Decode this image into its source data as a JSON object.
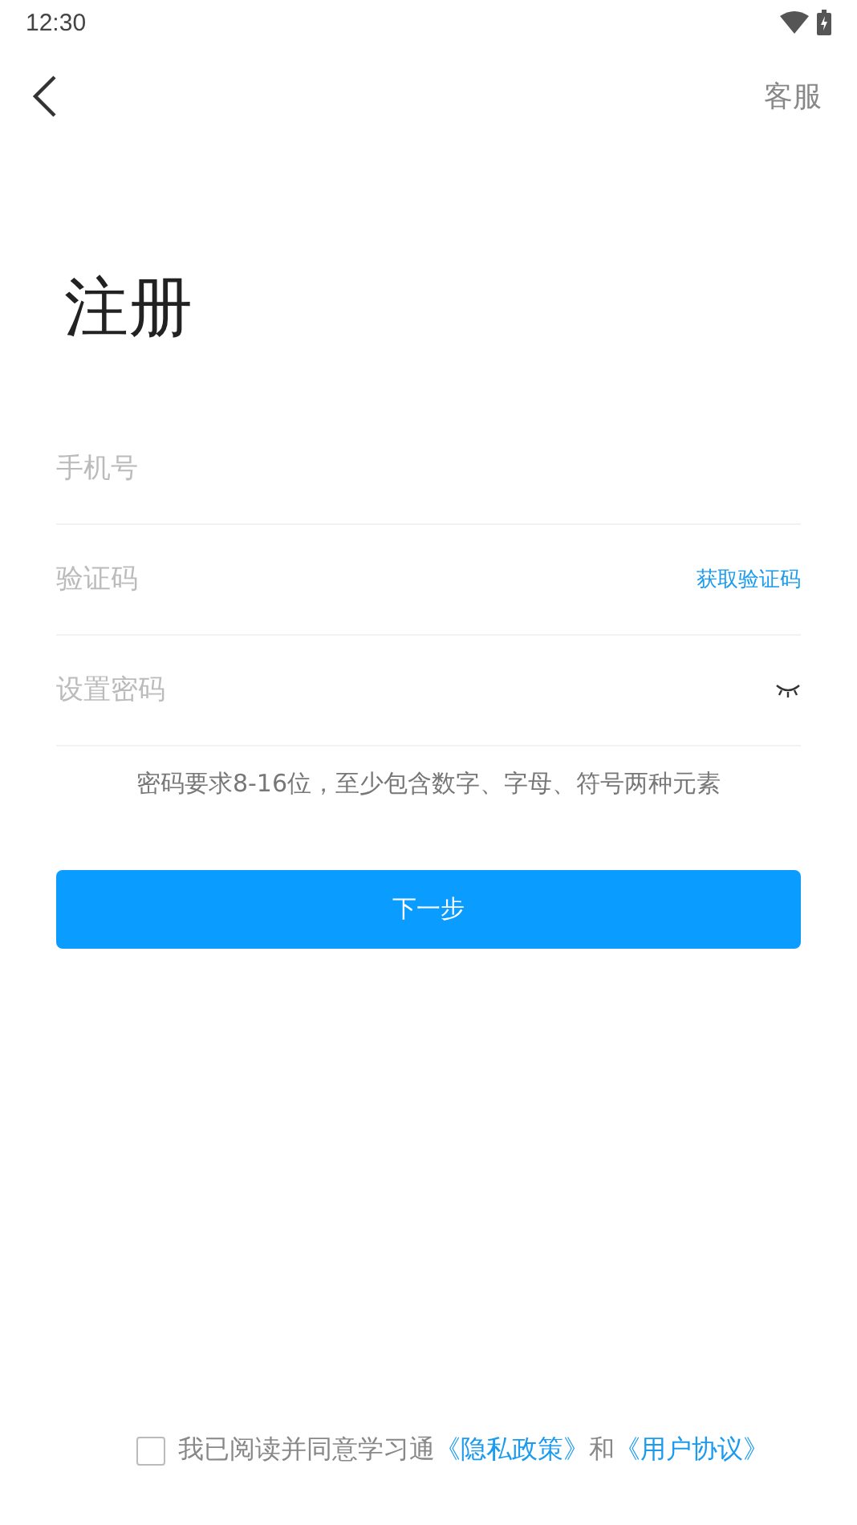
{
  "status_bar": {
    "time": "12:30"
  },
  "header": {
    "action": "客服"
  },
  "title": "注册",
  "fields": [
    {
      "kind": "plain",
      "placeholder": "手机号"
    },
    {
      "kind": "code",
      "placeholder": "验证码",
      "action": "获取验证码"
    },
    {
      "kind": "password",
      "placeholder": "设置密码"
    }
  ],
  "hint": "密码要求8-16位，至少包含数字、字母、符号两种元素",
  "submit": "下一步",
  "agreement": {
    "checked": false,
    "text": "我已阅读并同意学习通",
    "privacy_link": "《隐私政策》",
    "joiner": "和",
    "terms_link": "《用户协议》"
  }
}
